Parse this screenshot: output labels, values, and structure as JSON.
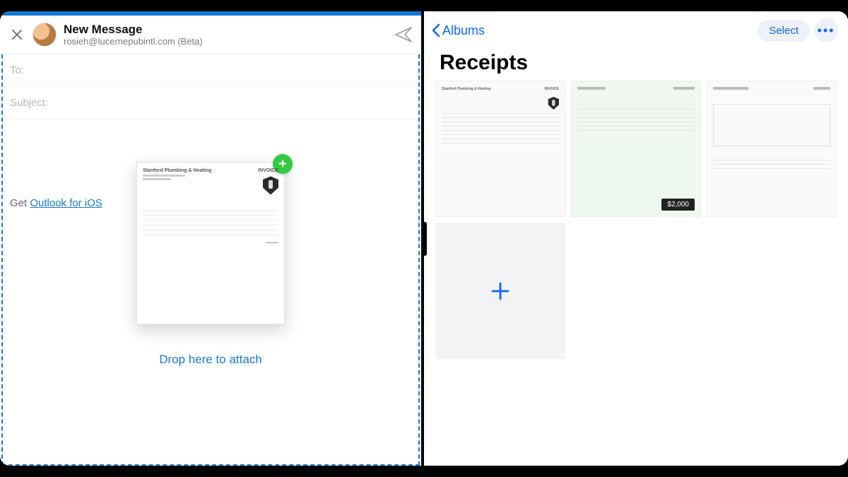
{
  "compose": {
    "title": "New Message",
    "email": "rosieh@lucernepubintl.com (Beta)",
    "to_label": "To:",
    "subject_label": "Subject:",
    "signature_prefix": "Get ",
    "signature_link": "Outlook for iOS",
    "drop_hint": "Drop here to attach",
    "dragged_doc": {
      "vendor": "Stanford Plumbing & Heating",
      "label": "INVOICE"
    }
  },
  "photos": {
    "back_label": "Albums",
    "select_label": "Select",
    "album_title": "Receipts",
    "thumbs": [
      {
        "kind": "invoice",
        "vendor": "Stanford Plumbing & Heating",
        "tag": "INVOICE"
      },
      {
        "kind": "invoice-green",
        "total": "$2,000"
      },
      {
        "kind": "invoice-plain"
      }
    ]
  }
}
